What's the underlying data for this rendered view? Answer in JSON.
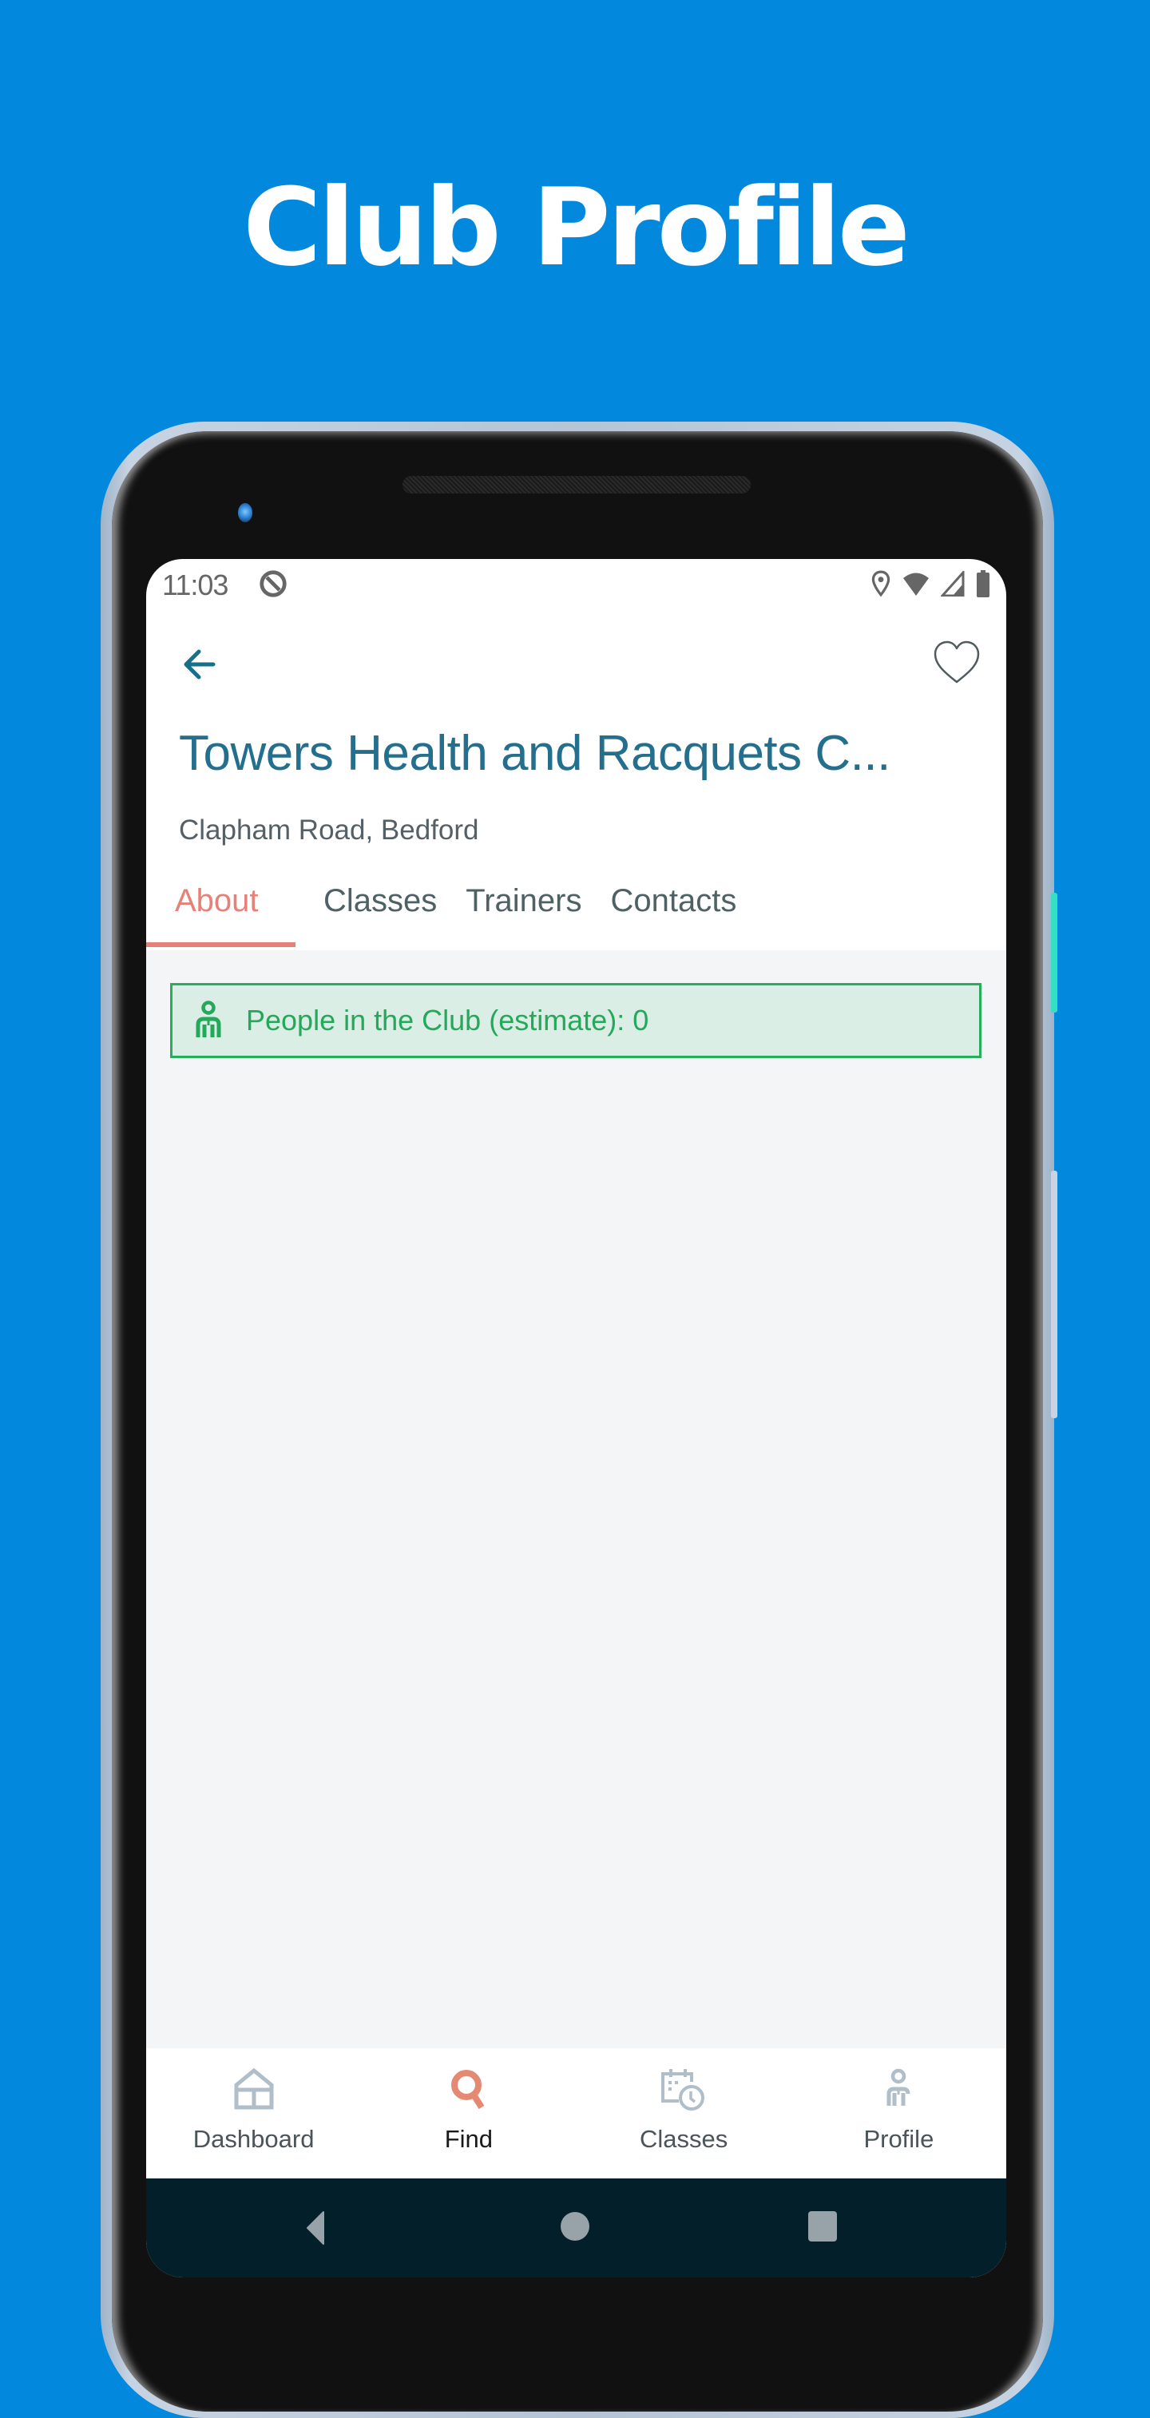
{
  "headline": "Club Profile",
  "colors": {
    "background": "#0289dd",
    "title": "#236f8d",
    "accent": "#e58178",
    "success": "#24a85a",
    "success_bg": "#dbeee5",
    "nav_icon_inactive": "#b0bec9",
    "system_nav": "#03202a"
  },
  "status_bar": {
    "time": "11:03",
    "icons": [
      "do-not-disturb-icon",
      "location-icon",
      "wifi-icon",
      "signal-icon",
      "battery-icon"
    ]
  },
  "header": {
    "back_icon": "arrow-left-icon",
    "favorite_icon": "heart-outline-icon",
    "club_name": "Towers Health and Racquets C...",
    "address": "Clapham Road, Bedford"
  },
  "tabs": [
    {
      "label": "About",
      "active": true
    },
    {
      "label": "Classes",
      "active": false
    },
    {
      "label": "Trainers",
      "active": false
    },
    {
      "label": "Contacts",
      "active": false
    }
  ],
  "about": {
    "occupancy_icon": "person-icon",
    "occupancy_label": "People in the Club (estimate): 0",
    "occupancy_count": 0
  },
  "bottom_nav": [
    {
      "label": "Dashboard",
      "icon": "house-icon",
      "active": false
    },
    {
      "label": "Find",
      "icon": "search-icon",
      "active": true
    },
    {
      "label": "Classes",
      "icon": "calendar-clock-icon",
      "active": false
    },
    {
      "label": "Profile",
      "icon": "person-icon",
      "active": false
    }
  ],
  "system_nav": [
    "back-triangle-icon",
    "home-circle-icon",
    "recents-square-icon"
  ]
}
